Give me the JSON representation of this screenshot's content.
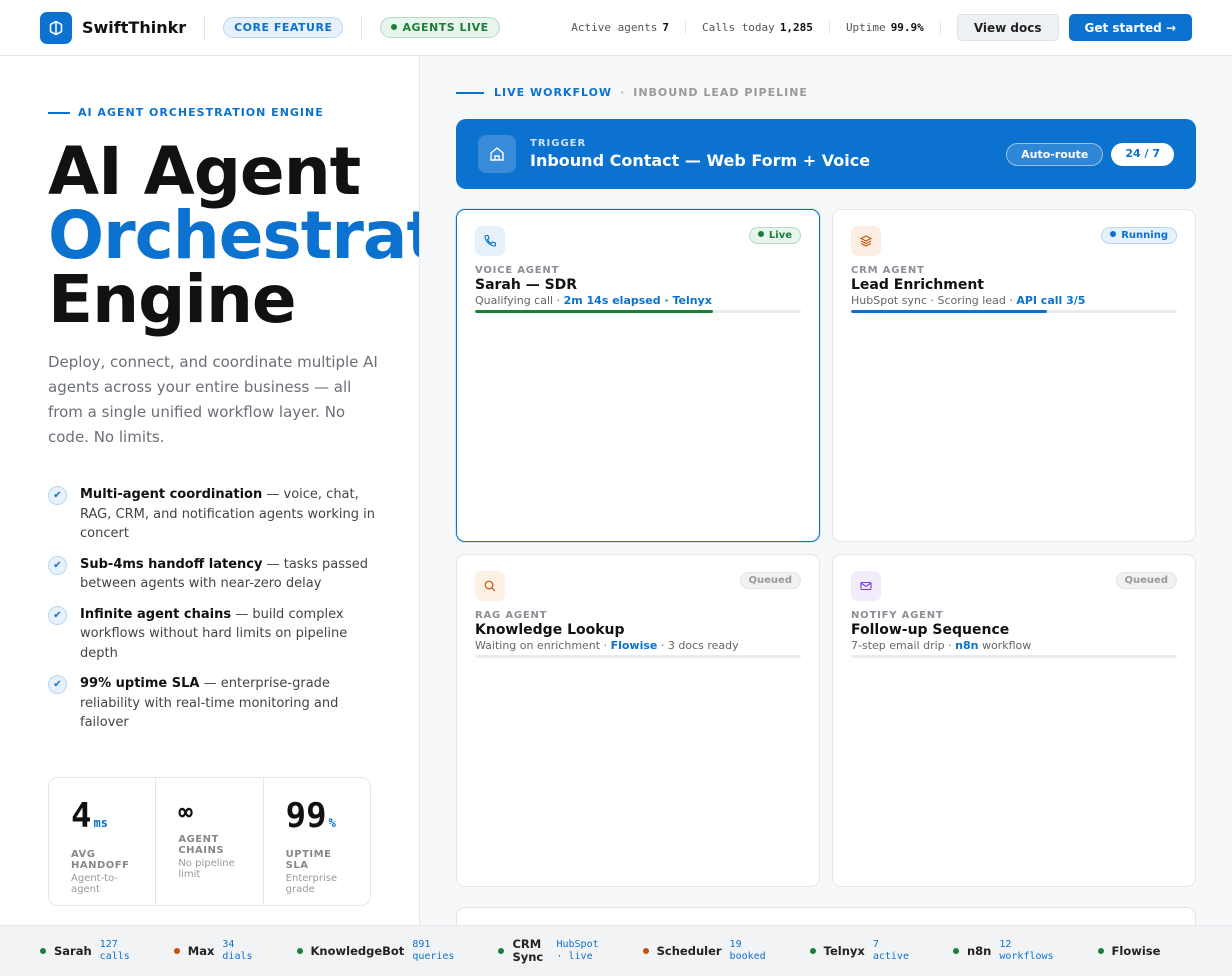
{
  "header": {
    "brand": "SwiftThinkr",
    "badge_core": "CORE FEATURE",
    "badge_live": "AGENTS LIVE",
    "stats": [
      {
        "label": "Active agents",
        "value": "7"
      },
      {
        "label": "Calls today",
        "value": "1,285"
      },
      {
        "label": "Uptime",
        "value": "99.9%"
      }
    ],
    "view_docs": "View docs",
    "get_started": "Get started →"
  },
  "hero": {
    "eyebrow": "AI AGENT ORCHESTRATION ENGINE",
    "title_line1": "AI Agent",
    "title_line2": "Orchestration",
    "title_line3": "Engine",
    "description": "Deploy, connect, and coordinate multiple AI agents across your entire business — all from a single unified workflow layer. No code. No limits.",
    "features": [
      {
        "bold": "Multi-agent coordination",
        "text": " — voice, chat, RAG, CRM, and notification agents working in concert"
      },
      {
        "bold": "Sub-4ms handoff latency",
        "text": " — tasks passed between agents with near-zero delay"
      },
      {
        "bold": "Infinite agent chains",
        "text": " — build complex workflows without hard limits on pipeline depth"
      },
      {
        "bold": "99% uptime SLA",
        "text": " — enterprise-grade reliability with real-time monitoring and failover"
      }
    ],
    "metrics": [
      {
        "value": "4",
        "unit": "ms",
        "label": "AVG HANDOFF",
        "sub": "Agent-to-agent"
      },
      {
        "value": "∞",
        "unit": "",
        "label": "AGENT CHAINS",
        "sub": "No pipeline limit"
      },
      {
        "value": "99",
        "unit": "%",
        "label": "UPTIME SLA",
        "sub": "Enterprise grade"
      }
    ]
  },
  "workflow": {
    "live_label": "LIVE WORKFLOW",
    "separator": "·",
    "pipeline_name": "INBOUND LEAD PIPELINE",
    "trigger": {
      "label": "TRIGGER",
      "title": "Inbound Contact — Web Form + Voice",
      "badge_route": "Auto-route",
      "badge_hours": "24 / 7"
    },
    "cards": [
      {
        "type": "VOICE AGENT",
        "title": "Sarah — SDR",
        "status": "Live",
        "sub_pre": "Qualifying call · ",
        "sub_hl": "2m 14s elapsed · Telnyx",
        "sub_post": "",
        "progress": 0.73,
        "icon": "phone-icon",
        "bar_color": "#1a7f37"
      },
      {
        "type": "CRM AGENT",
        "title": "Lead Enrichment",
        "status": "Running",
        "sub_pre": "HubSpot sync · Scoring lead · ",
        "sub_hl": "API call 3/5",
        "sub_post": "",
        "progress": 0.6,
        "icon": "layers-icon",
        "bar_color": "#0b72d0"
      },
      {
        "type": "RAG AGENT",
        "title": "Knowledge Lookup",
        "status": "Queued",
        "sub_pre": "Waiting on enrichment · ",
        "sub_hl": "Flowise",
        "sub_post": " · 3 docs ready",
        "progress": 0,
        "icon": "search-icon",
        "bar_color": "#0b72d0"
      },
      {
        "type": "NOTIFY AGENT",
        "title": "Follow-up Sequence",
        "status": "Queued",
        "sub_pre": "7-step email drip · ",
        "sub_hl": "n8n",
        "sub_post": " workflow",
        "progress": 0,
        "icon": "mail-icon",
        "bar_color": "#0b72d0"
      }
    ]
  },
  "ticker": [
    {
      "name": "Sarah",
      "val1": "127",
      "val2": "calls",
      "color": "#1a7f37"
    },
    {
      "name": "Max",
      "val1": "34",
      "val2": "dials",
      "color": "#c2540a"
    },
    {
      "name": "KnowledgeBot",
      "val1": "891",
      "val2": "queries",
      "color": "#1a7f37"
    },
    {
      "name": "CRM Sync",
      "val1": "HubSpot",
      "val2": "· live",
      "color": "#1a7f37"
    },
    {
      "name": "Scheduler",
      "val1": "19",
      "val2": "booked",
      "color": "#c2540a"
    },
    {
      "name": "Telnyx",
      "val1": "7",
      "val2": "active",
      "color": "#1a7f37"
    },
    {
      "name": "n8n",
      "val1": "12",
      "val2": "workflows",
      "color": "#1a7f37"
    },
    {
      "name": "Flowise",
      "val1": "",
      "val2": "",
      "color": "#1a7f37"
    }
  ]
}
